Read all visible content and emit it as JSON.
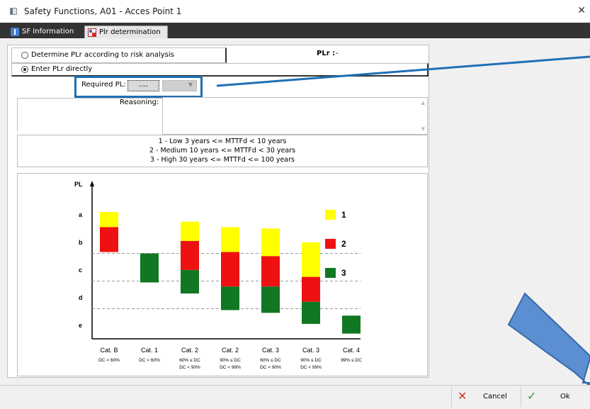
{
  "window": {
    "title": "Safety Functions, A01 - Acces Point 1",
    "close": "✕"
  },
  "tabs": [
    {
      "label": "SF Information"
    },
    {
      "label": "Plr determination"
    }
  ],
  "form": {
    "option_risk": "Determine PLr according to risk analysis",
    "option_direct": "Enter PLr directly",
    "plr_label": "PLr :",
    "plr_value": "-",
    "required_pl_label": "Required PL:",
    "required_pl_button": "....",
    "reasoning_label": "Reasoning:"
  },
  "legend": [
    "1 - Low 3 years <= MTTFd < 10 years",
    "2 - Medium 10 years <= MTTFd < 30 years",
    "3 - High 30 years <= MTTFd <= 100 years"
  ],
  "chart_data": {
    "type": "bar",
    "ylabel": "PL",
    "y_levels": [
      "a",
      "b",
      "c",
      "d",
      "e"
    ],
    "categories": [
      {
        "name": "Cat. B",
        "condition": "DC < 60%"
      },
      {
        "name": "Cat. 1",
        "condition": "DC < 60%"
      },
      {
        "name": "Cat. 2",
        "condition": "60% ≤ DC",
        "condition2": "DC < 90%"
      },
      {
        "name": "Cat. 2",
        "condition": "90% ≤ DC",
        "condition2": "DC < 99%"
      },
      {
        "name": "Cat. 3",
        "condition": "60% ≤ DC",
        "condition2": "DC < 90%"
      },
      {
        "name": "Cat. 3",
        "condition": "90% ≤ DC",
        "condition2": "DC < 99%"
      },
      {
        "name": "Cat. 4",
        "condition": "99% ≤ DC"
      }
    ],
    "series": [
      {
        "name": "1",
        "color": "#ffff00",
        "ranges": [
          [
            0.2,
            0.75
          ],
          [
            null,
            null
          ],
          [
            0.55,
            1.25
          ],
          [
            0.75,
            1.65
          ],
          [
            0.8,
            1.8
          ],
          [
            1.3,
            2.55
          ],
          [
            null,
            null
          ]
        ]
      },
      {
        "name": "2",
        "color": "#ee1111",
        "ranges": [
          [
            0.75,
            1.65
          ],
          [
            null,
            null
          ],
          [
            1.25,
            2.3
          ],
          [
            1.65,
            2.9
          ],
          [
            1.8,
            2.9
          ],
          [
            2.55,
            3.45
          ],
          [
            null,
            null
          ]
        ]
      },
      {
        "name": "3",
        "color": "#117722",
        "ranges": [
          [
            null,
            null
          ],
          [
            1.7,
            2.75
          ],
          [
            2.3,
            3.15
          ],
          [
            2.9,
            3.75
          ],
          [
            2.9,
            3.85
          ],
          [
            3.45,
            4.25
          ],
          [
            3.95,
            4.6
          ]
        ]
      }
    ]
  },
  "buttons": {
    "cancel": "Cancel",
    "ok": "Ok"
  }
}
